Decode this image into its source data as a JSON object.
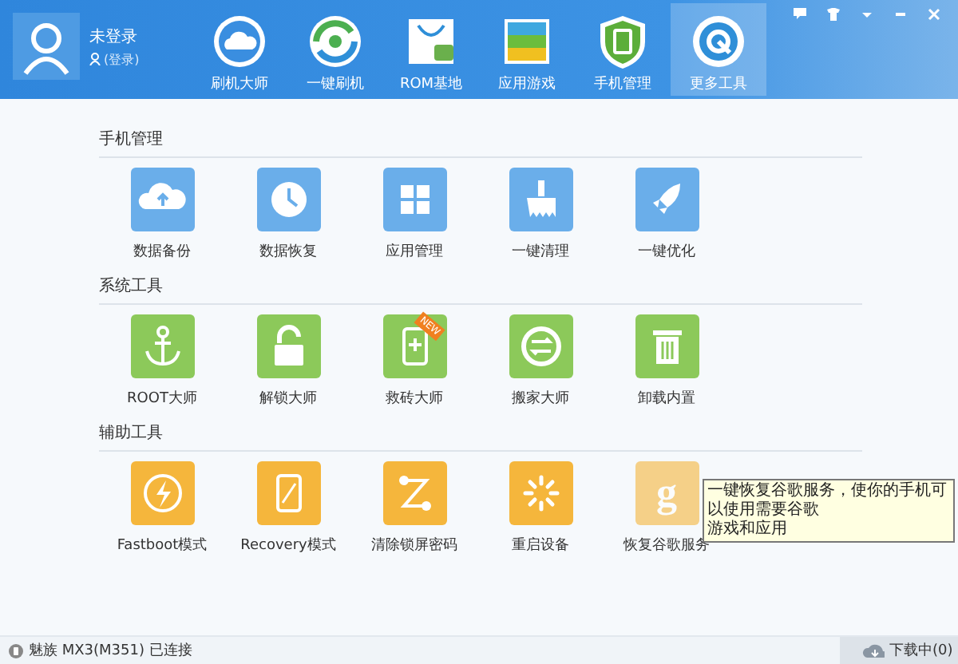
{
  "header": {
    "user": {
      "name": "未登录",
      "login": "(登录)"
    },
    "nav": [
      {
        "label": "刷机大师",
        "selected": false
      },
      {
        "label": "一键刷机",
        "selected": false
      },
      {
        "label": "ROM基地",
        "selected": false
      },
      {
        "label": "应用游戏",
        "selected": false
      },
      {
        "label": "手机管理",
        "selected": false
      },
      {
        "label": "更多工具",
        "selected": true
      }
    ]
  },
  "sections": [
    {
      "title": "手机管理",
      "color": "#6aaeea",
      "tools": [
        {
          "label": "数据备份"
        },
        {
          "label": "数据恢复"
        },
        {
          "label": "应用管理"
        },
        {
          "label": "一键清理"
        },
        {
          "label": "一键优化"
        }
      ]
    },
    {
      "title": "系统工具",
      "color": "#8cc95a",
      "tools": [
        {
          "label": "ROOT大师"
        },
        {
          "label": "解锁大师"
        },
        {
          "label": "救砖大师",
          "badge": "NEW"
        },
        {
          "label": "搬家大师"
        },
        {
          "label": "卸载内置"
        }
      ]
    },
    {
      "title": "辅助工具",
      "color": "#f5b63c",
      "tools": [
        {
          "label": "Fastboot模式"
        },
        {
          "label": "Recovery模式"
        },
        {
          "label": "清除锁屏密码"
        },
        {
          "label": "重启设备"
        },
        {
          "label": "恢复谷歌服务",
          "disabled": true,
          "glyph": "g"
        }
      ]
    }
  ],
  "tooltip": {
    "lines": [
      "一键恢复谷歌服务，使你的手机可以使用需要谷歌",
      "游戏和应用"
    ]
  },
  "status_bar": {
    "device": "魅族 MX3(M351) 已连接",
    "downloads": "下载中(0)"
  }
}
